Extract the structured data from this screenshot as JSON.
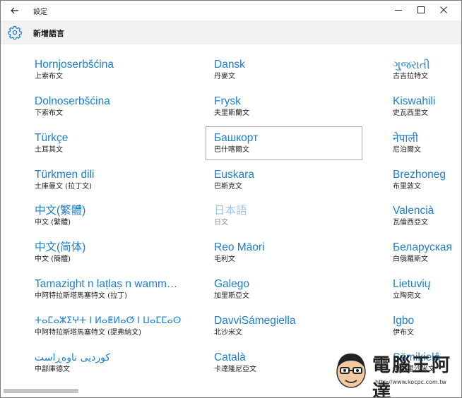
{
  "window": {
    "title": "設定"
  },
  "header": {
    "title": "新增語言"
  },
  "languages": [
    {
      "name": "Hornjoserbšćina",
      "sub": "上索布文"
    },
    {
      "name": "Dolnoserbšćina",
      "sub": "下索布文"
    },
    {
      "name": "Türkçe",
      "sub": "土耳其文"
    },
    {
      "name": "Türkmen dili",
      "sub": "土庫曼文 (拉丁文)"
    },
    {
      "name": "中文(繁體)",
      "sub": "中文 (繁體)"
    },
    {
      "name": "中文(简体)",
      "sub": "中文 (簡體)"
    },
    {
      "name": "Tamazight n laṭlaṣ n wamm…",
      "sub": "中阿特拉斯塔馬塞特文 (拉丁)"
    },
    {
      "name": "ⵜⴰⵎⴰⵣⵉⵖⵜ ⵏ ⵍⴰⵟⵍⴰⵚ ⵏ ⵡⴰⵎⵎⴰⵙ",
      "sub": "中阿特拉斯塔馬塞特文 (提弗納文)"
    },
    {
      "name": "کوردیی ناوەڕاست",
      "sub": "中部庫德文"
    },
    {
      "name": "Dansk",
      "sub": "丹麥文"
    },
    {
      "name": "Frysk",
      "sub": "夫里斯蘭文"
    },
    {
      "name": "Башкорт",
      "sub": "巴什喀爾文"
    },
    {
      "name": "Euskara",
      "sub": "巴斯克文"
    },
    {
      "name": "日本語",
      "sub": "日文"
    },
    {
      "name": "Reo Māori",
      "sub": "毛利文"
    },
    {
      "name": "Galego",
      "sub": "加里斯亞文"
    },
    {
      "name": "DavviSámegiella",
      "sub": "北沙米文"
    },
    {
      "name": "Català",
      "sub": "卡達隆尼亞文"
    },
    {
      "name": "ગુજરાતી",
      "sub": "古吉拉特文"
    },
    {
      "name": "Kiswahili",
      "sub": "史瓦西里文"
    },
    {
      "name": "नेपाली",
      "sub": "尼泊爾文"
    },
    {
      "name": "Brezhoneg",
      "sub": "布里敦文"
    },
    {
      "name": "Valencià",
      "sub": "瓦倫西亞文"
    },
    {
      "name": "Беларуская",
      "sub": "白俄羅斯文"
    },
    {
      "name": "Lietuvių",
      "sub": "立陶宛文"
    },
    {
      "name": "Igbo",
      "sub": "伊布文"
    },
    {
      "name": "Sämikielâ",
      "sub": "伊納里沙米文"
    }
  ],
  "watermark": {
    "text": "電腦王阿達",
    "url": "http://www.kocpc.com.tw"
  }
}
